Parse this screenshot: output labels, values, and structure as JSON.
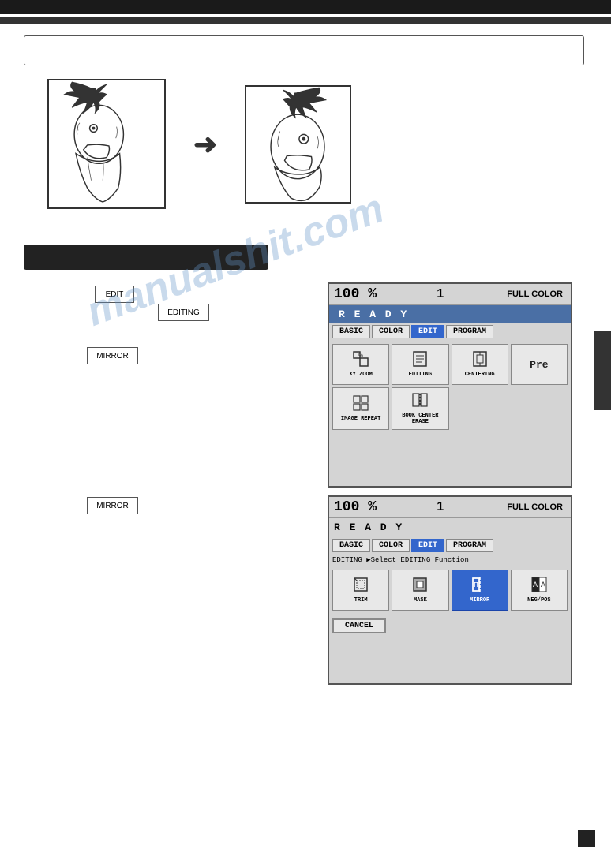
{
  "page": {
    "top_bar": "top-navigation-bar",
    "info_box_text": ""
  },
  "watermark": "manualshit.com",
  "arrow": "→",
  "black_label": "",
  "step_boxes": [
    {
      "id": 1,
      "label": "EDIT"
    },
    {
      "id": 2,
      "label": "EDITING"
    },
    {
      "id": 3,
      "label": "MIRROR"
    },
    {
      "id": 4,
      "label": "MIRROR"
    }
  ],
  "panel1": {
    "percent": "100 %",
    "num": "1",
    "color_label": "FULL COLOR",
    "ready_text": "R E A D Y",
    "tabs": [
      {
        "label": "BASIC",
        "active": false
      },
      {
        "label": "COLOR",
        "active": false
      },
      {
        "label": "EDIT",
        "active": true
      },
      {
        "label": "PROGRAM",
        "active": false
      }
    ],
    "icons": [
      {
        "symbol": "⊞",
        "label": "XY ZOOM",
        "selected": false
      },
      {
        "symbol": "✎",
        "label": "EDITING",
        "selected": false
      },
      {
        "symbol": "⊡",
        "label": "CENTERING",
        "selected": false
      },
      {
        "symbol": "Pre",
        "label": "",
        "selected": false,
        "is_pre": true
      },
      {
        "symbol": "⊞",
        "label": "IMAGE REPEAT",
        "selected": false
      },
      {
        "symbol": "📖",
        "label": "BOOK CENTER\nERASE",
        "selected": false
      }
    ]
  },
  "panel2": {
    "percent": "100 %",
    "num": "1",
    "color_label": "FULL COLOR",
    "ready_text": "R E A D Y",
    "tabs": [
      {
        "label": "BASIC",
        "active": false
      },
      {
        "label": "COLOR",
        "active": false
      },
      {
        "label": "EDIT",
        "active": true
      },
      {
        "label": "PROGRAM",
        "active": false
      }
    ],
    "subheader": "EDITING    ▶Select EDITING Function",
    "icons": [
      {
        "symbol": "✂",
        "label": "TRIM",
        "selected": false
      },
      {
        "symbol": "◼",
        "label": "MASK",
        "selected": false
      },
      {
        "symbol": "↔",
        "label": "MIRROR",
        "selected": true
      },
      {
        "symbol": "⊟",
        "label": "NEG/POS",
        "selected": false
      }
    ],
    "cancel_label": "CANCEL"
  }
}
